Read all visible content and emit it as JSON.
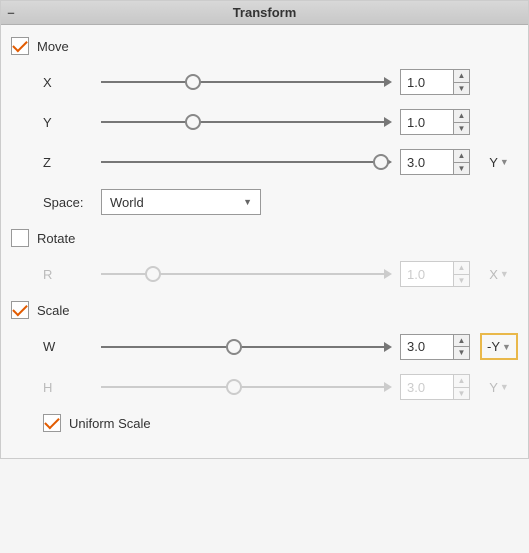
{
  "panel": {
    "title": "Transform",
    "collapse_glyph": "–"
  },
  "move": {
    "label": "Move",
    "checked": true,
    "x": {
      "label": "X",
      "value": "1.0",
      "thumb_pct": 32
    },
    "y": {
      "label": "Y",
      "value": "1.0",
      "thumb_pct": 32
    },
    "z": {
      "label": "Z",
      "value": "3.0",
      "thumb_pct": 97,
      "axis": "Y"
    },
    "space": {
      "label": "Space:",
      "value": "World"
    }
  },
  "rotate": {
    "label": "Rotate",
    "checked": false,
    "r": {
      "label": "R",
      "value": "1.0",
      "thumb_pct": 18,
      "axis": "X"
    }
  },
  "scale": {
    "label": "Scale",
    "checked": true,
    "w": {
      "label": "W",
      "value": "3.0",
      "thumb_pct": 46,
      "axis": "-Y"
    },
    "h": {
      "label": "H",
      "value": "3.0",
      "thumb_pct": 46,
      "axis": "Y"
    },
    "uniform": {
      "label": "Uniform Scale",
      "checked": true
    }
  }
}
